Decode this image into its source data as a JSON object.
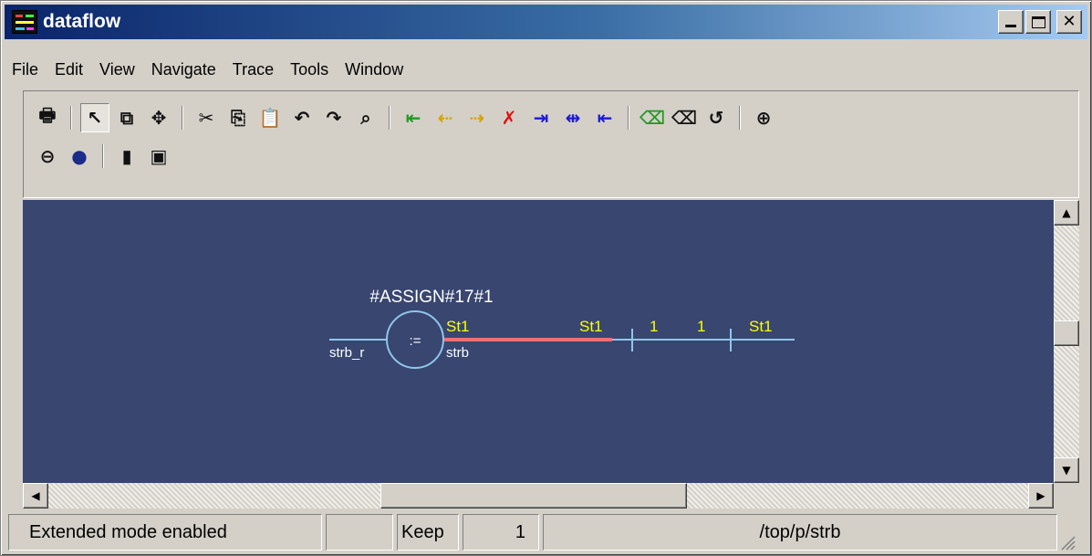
{
  "window": {
    "title": "dataflow"
  },
  "menu": [
    "File",
    "Edit",
    "View",
    "Navigate",
    "Trace",
    "Tools",
    "Window"
  ],
  "toolbar": {
    "row1": [
      {
        "name": "print-icon",
        "glyph": "🖶",
        "color": "black"
      },
      {
        "sep": true
      },
      {
        "name": "select-pointer-icon",
        "glyph": "↖",
        "color": "black",
        "pressed": true
      },
      {
        "name": "zoom-area-icon",
        "glyph": "⧉",
        "color": "black"
      },
      {
        "name": "pan-move-icon",
        "glyph": "✥",
        "color": "black"
      },
      {
        "sep": true
      },
      {
        "name": "cut-icon",
        "glyph": "✂",
        "color": "black"
      },
      {
        "name": "copy-icon",
        "glyph": "⎘",
        "color": "black"
      },
      {
        "name": "paste-icon",
        "glyph": "📋",
        "color": "black"
      },
      {
        "name": "undo-icon",
        "glyph": "↶",
        "color": "black"
      },
      {
        "name": "redo-icon",
        "glyph": "↷",
        "color": "black"
      },
      {
        "name": "find-binoculars-icon",
        "glyph": "⌕",
        "color": "black"
      },
      {
        "sep": true
      },
      {
        "name": "trace-input-icon",
        "glyph": "⇤",
        "color": "green"
      },
      {
        "name": "trace-back-icon",
        "glyph": "⇠",
        "color": "yellow"
      },
      {
        "name": "trace-forward-icon",
        "glyph": "⇢",
        "color": "yellow"
      },
      {
        "name": "trace-x-icon",
        "glyph": "✗",
        "color": "red"
      },
      {
        "name": "expand-in-icon",
        "glyph": "⇥",
        "color": "blue"
      },
      {
        "name": "expand-both-icon",
        "glyph": "⇹",
        "color": "blue"
      },
      {
        "name": "expand-out-icon",
        "glyph": "⇤",
        "color": "blue"
      },
      {
        "sep": true
      },
      {
        "name": "erase-green-icon",
        "glyph": "⌫",
        "color": "green"
      },
      {
        "name": "erase-icon",
        "glyph": "⌫",
        "color": "black"
      },
      {
        "name": "regenerate-icon",
        "glyph": "↺",
        "color": "black"
      },
      {
        "sep": true
      },
      {
        "name": "zoom-in-icon",
        "glyph": "⊕",
        "color": "black"
      }
    ],
    "row2": [
      {
        "name": "zoom-out-icon",
        "glyph": "⊖",
        "color": "black"
      },
      {
        "name": "zoom-full-icon",
        "glyph": "●",
        "color": "navy"
      },
      {
        "sep": true
      },
      {
        "name": "traffic-light-icon",
        "glyph": "▮",
        "color": "black"
      },
      {
        "name": "wave-window-icon",
        "glyph": "▣",
        "color": "black"
      }
    ]
  },
  "diagram": {
    "instance_label": "#ASSIGN#17#1",
    "operator": ":=",
    "input_port": "strb_r",
    "output_port": "strb",
    "output_value": "St1",
    "signal_values": [
      "St1",
      "1",
      "1",
      "St1"
    ],
    "colors": {
      "background": "#384670",
      "wire": "#8fc6ea",
      "highlight": "#ee7070",
      "value_text": "#ffff00",
      "label_text": "#ffffff"
    }
  },
  "status": {
    "mode": "Extended mode enabled",
    "empty": "",
    "keep_label": "Keep",
    "keep_count": "1",
    "path": "/top/p/strb"
  }
}
